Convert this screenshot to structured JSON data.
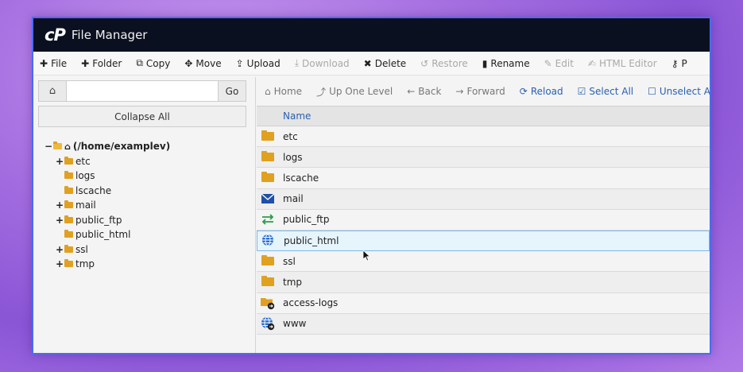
{
  "app": {
    "logo": "cP",
    "title": "File Manager"
  },
  "toolbar": [
    {
      "key": "file",
      "icon": "plus-icon",
      "glyph": "✚",
      "label": "File",
      "enabled": true
    },
    {
      "key": "folder",
      "icon": "plus-icon",
      "glyph": "✚",
      "label": "Folder",
      "enabled": true
    },
    {
      "key": "copy",
      "icon": "copy-icon",
      "glyph": "⧉",
      "label": "Copy",
      "enabled": true
    },
    {
      "key": "move",
      "icon": "move-icon",
      "glyph": "✥",
      "label": "Move",
      "enabled": true
    },
    {
      "key": "upload",
      "icon": "upload-icon",
      "glyph": "⇪",
      "label": "Upload",
      "enabled": true
    },
    {
      "key": "download",
      "icon": "download-icon",
      "glyph": "⤓",
      "label": "Download",
      "enabled": false
    },
    {
      "key": "delete",
      "icon": "x-icon",
      "glyph": "✖",
      "label": "Delete",
      "enabled": true
    },
    {
      "key": "restore",
      "icon": "restore-icon",
      "glyph": "↺",
      "label": "Restore",
      "enabled": false
    },
    {
      "key": "rename",
      "icon": "file-icon",
      "glyph": "▮",
      "label": "Rename",
      "enabled": true
    },
    {
      "key": "edit",
      "icon": "pencil-icon",
      "glyph": "✎",
      "label": "Edit",
      "enabled": false
    },
    {
      "key": "html-editor",
      "icon": "html-editor-icon",
      "glyph": "✍",
      "label": "HTML Editor",
      "enabled": false
    },
    {
      "key": "permissions",
      "icon": "key-icon",
      "glyph": "⚷",
      "label": "P",
      "enabled": true
    }
  ],
  "left": {
    "home_glyph": "⌂",
    "path_value": "",
    "go_label": "Go",
    "collapse_label": "Collapse All",
    "root_label": "(/home/examplev)",
    "tree": [
      {
        "name": "etc",
        "toggle": "+"
      },
      {
        "name": "logs",
        "toggle": ""
      },
      {
        "name": "lscache",
        "toggle": ""
      },
      {
        "name": "mail",
        "toggle": "+"
      },
      {
        "name": "public_ftp",
        "toggle": "+"
      },
      {
        "name": "public_html",
        "toggle": ""
      },
      {
        "name": "ssl",
        "toggle": "+"
      },
      {
        "name": "tmp",
        "toggle": "+"
      }
    ]
  },
  "actions": [
    {
      "key": "home",
      "icon": "home-icon",
      "glyph": "⌂",
      "label": "Home",
      "style": "gray"
    },
    {
      "key": "up",
      "icon": "up-level-icon",
      "glyph": "⤴",
      "label": "Up One Level",
      "style": "gray"
    },
    {
      "key": "back",
      "icon": "arrow-left-icon",
      "glyph": "←",
      "label": "Back",
      "style": "gray"
    },
    {
      "key": "forward",
      "icon": "arrow-right-icon",
      "glyph": "→",
      "label": "Forward",
      "style": "gray"
    },
    {
      "key": "reload",
      "icon": "reload-icon",
      "glyph": "⟳",
      "label": "Reload",
      "style": "blue"
    },
    {
      "key": "select-all",
      "icon": "checkbox-checked-icon",
      "glyph": "☑",
      "label": "Select All",
      "style": "blue"
    },
    {
      "key": "unselect-all",
      "icon": "checkbox-empty-icon",
      "glyph": "☐",
      "label": "Unselect All",
      "style": "blue"
    }
  ],
  "list": {
    "header_name": "Name",
    "rows": [
      {
        "name": "etc",
        "icon": "folder-icon",
        "kind": "folder"
      },
      {
        "name": "logs",
        "icon": "folder-icon",
        "kind": "folder"
      },
      {
        "name": "lscache",
        "icon": "folder-icon",
        "kind": "folder"
      },
      {
        "name": "mail",
        "icon": "mail-icon",
        "kind": "mail"
      },
      {
        "name": "public_ftp",
        "icon": "ftp-transfer-icon",
        "kind": "ftp"
      },
      {
        "name": "public_html",
        "icon": "globe-icon",
        "kind": "globe",
        "selected": true
      },
      {
        "name": "ssl",
        "icon": "folder-icon",
        "kind": "folder"
      },
      {
        "name": "tmp",
        "icon": "folder-icon",
        "kind": "folder"
      },
      {
        "name": "access-logs",
        "icon": "folder-link-icon",
        "kind": "folder-link"
      },
      {
        "name": "www",
        "icon": "globe-link-icon",
        "kind": "globe-link"
      }
    ]
  },
  "colors": {
    "accent": "#2a5fb0",
    "folder": "#e0a020",
    "titlebar": "#0b1020",
    "selection": "#e6f4fc"
  }
}
